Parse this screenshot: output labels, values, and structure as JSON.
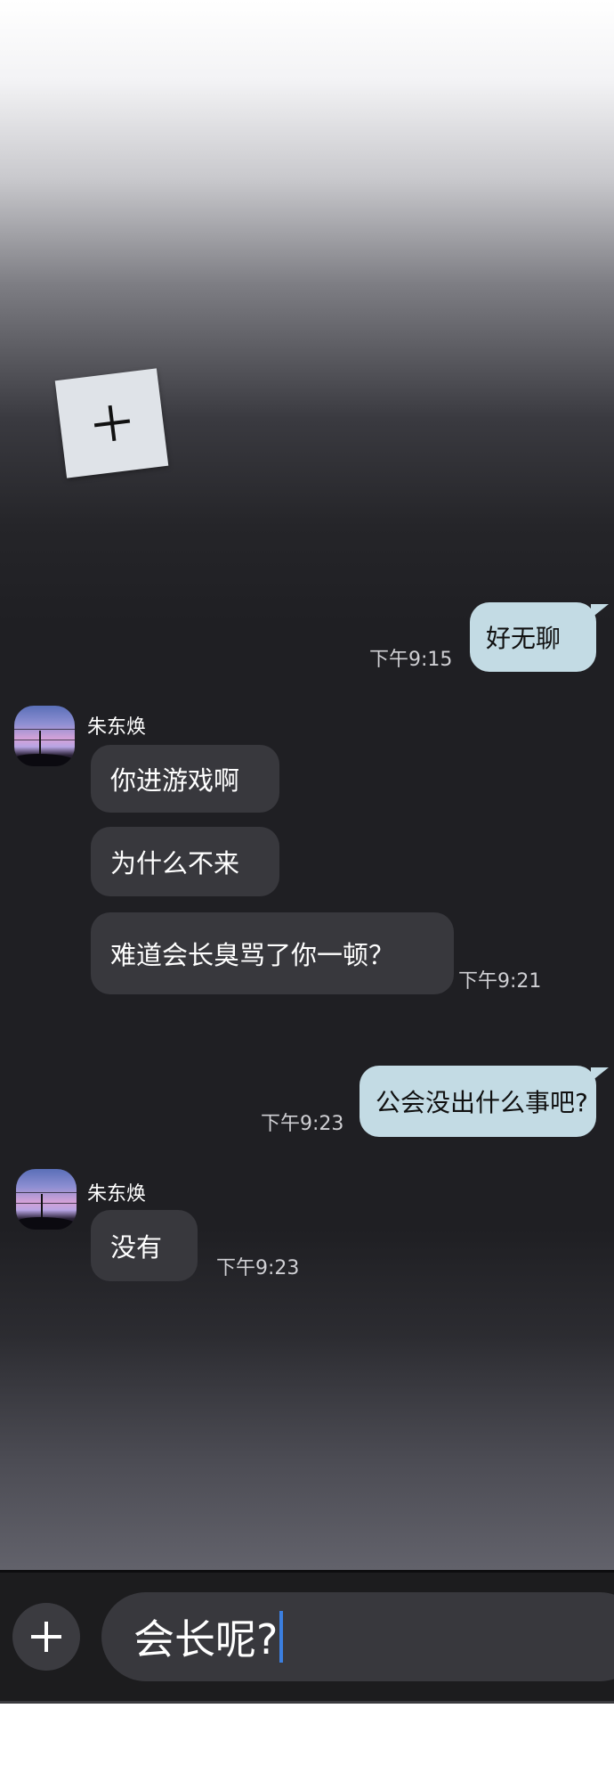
{
  "chat": {
    "messages": [
      {
        "id": "m1",
        "direction": "outgoing",
        "text": "好无聊",
        "time": "下午9:15"
      },
      {
        "id": "m2",
        "direction": "incoming",
        "sender": "朱东焕",
        "texts": [
          "你进游戏啊",
          "为什么不来",
          "难道会长臭骂了你一顿？"
        ],
        "time": "下午9:21"
      },
      {
        "id": "m3",
        "direction": "outgoing",
        "text": "公会没出什么事吧?",
        "time": "下午9:23"
      },
      {
        "id": "m4",
        "direction": "incoming",
        "sender": "朱东焕",
        "texts": [
          "没有"
        ],
        "time": "下午9:23"
      }
    ]
  },
  "composer": {
    "draft_text": "会长呢?",
    "add_icon": "plus-icon"
  },
  "decor": {
    "sticky_note_icon": "plus-icon"
  },
  "colors": {
    "incoming_bubble": "#38383d",
    "outgoing_bubble": "#c3dbe4",
    "caret": "#3b7fe0"
  }
}
